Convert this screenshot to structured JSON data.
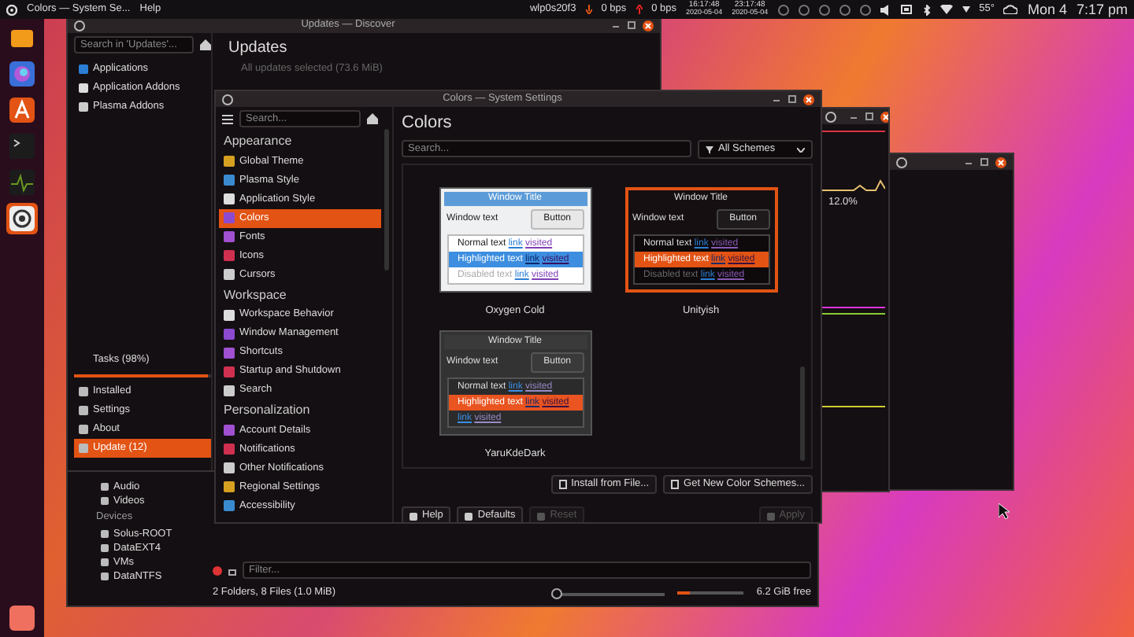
{
  "top_bar": {
    "app_title": "Colors — System Se...",
    "menu": "Help",
    "network": "wlp0s20f3",
    "download": "0 bps",
    "upload": "0 bps",
    "clocks": [
      {
        "time": "16:17:48",
        "date": "2020-05-04"
      },
      {
        "time": "23:17:48",
        "date": "2020-05-04"
      }
    ],
    "temperature": "55°",
    "day": "Mon 4",
    "time": "7:17 pm"
  },
  "dock": {
    "items": [
      {
        "selected": false
      },
      {
        "selected": false
      },
      {
        "selected": false
      },
      {
        "selected": false
      },
      {
        "selected": false
      },
      {
        "selected": true
      }
    ]
  },
  "files_window": {
    "places": [
      "Audio",
      "Videos"
    ],
    "devices_header": "Devices",
    "devices": [
      "Solus-ROOT",
      "DataEXT4",
      "VMs",
      "DataNTFS"
    ],
    "filter": {
      "placeholder": "Filter..."
    },
    "status": "2 Folders, 8 Files (1.0 MiB)",
    "zoom_slider": {
      "level": 0.0
    },
    "disk_usage": {
      "level": 0.18
    },
    "free_space": "6.2 GiB free"
  },
  "discover_window": {
    "title": "Updates — Discover",
    "search": {
      "placeholder": "Search in 'Updates'..."
    },
    "categories": [
      "Applications",
      "Application Addons",
      "Plasma Addons"
    ],
    "tasks": {
      "label": "Tasks (98%)",
      "level": 0.98
    },
    "nav": [
      {
        "label": "Installed",
        "selected": false
      },
      {
        "label": "Settings",
        "selected": false
      },
      {
        "label": "About",
        "selected": false
      },
      {
        "label": "Update (12)",
        "selected": true
      }
    ],
    "heading": "Updates",
    "summary": "All updates selected (73.6 MiB)"
  },
  "monitor_window": {
    "reading": "12.0%"
  },
  "settings_window": {
    "title": "Colors — System Settings",
    "search": {
      "placeholder": "Search..."
    },
    "sections": [
      {
        "title": "Appearance",
        "items": [
          {
            "label": "Global Theme",
            "selected": false
          },
          {
            "label": "Plasma Style",
            "selected": false
          },
          {
            "label": "Application Style",
            "selected": false
          },
          {
            "label": "Colors",
            "selected": true
          },
          {
            "label": "Fonts",
            "selected": false
          },
          {
            "label": "Icons",
            "selected": false
          },
          {
            "label": "Cursors",
            "selected": false
          }
        ]
      },
      {
        "title": "Workspace",
        "items": [
          {
            "label": "Workspace Behavior",
            "selected": false
          },
          {
            "label": "Window Management",
            "selected": false
          },
          {
            "label": "Shortcuts",
            "selected": false
          },
          {
            "label": "Startup and Shutdown",
            "selected": false
          },
          {
            "label": "Search",
            "selected": false
          }
        ]
      },
      {
        "title": "Personalization",
        "items": [
          {
            "label": "Account Details",
            "selected": false
          },
          {
            "label": "Notifications",
            "selected": false
          },
          {
            "label": "Other Notifications",
            "selected": false
          },
          {
            "label": "Regional Settings",
            "selected": false
          },
          {
            "label": "Accessibility",
            "selected": false
          }
        ]
      }
    ],
    "page_title": "Colors",
    "scheme_search": {
      "placeholder": "Search..."
    },
    "scheme_filter": "All Schemes",
    "schemes": [
      {
        "name": "Oxygen Cold",
        "kind": "light",
        "selected": false,
        "title_bar": "Window Title",
        "window_text": "Window text",
        "button": "Button",
        "normal_text": "Normal text",
        "link": "link",
        "visited": "visited",
        "highlighted_text": "Highlighted text",
        "highlighted_link": "link",
        "highlighted_visited": "visited",
        "disabled_text": "Disabled text",
        "disabled_link": "link",
        "disabled_visited": "visited"
      },
      {
        "name": "Unityish",
        "kind": "dark",
        "selected": true,
        "title_bar": "Window Title",
        "window_text": "Window text",
        "button": "Button",
        "normal_text": "Normal text",
        "link": "link",
        "visited": "visited",
        "highlighted_text": "Highlighted text",
        "highlighted_link": "link",
        "highlighted_visited": "visited",
        "disabled_text": "Disabled text",
        "disabled_link": "link",
        "disabled_visited": "visited"
      },
      {
        "name": "YaruKdeDark",
        "kind": "grey",
        "selected": false,
        "title_bar": "Window Title",
        "window_text": "Window text",
        "button": "Button",
        "normal_text": "Normal text",
        "link": "link",
        "visited": "visited",
        "highlighted_text": "Highlighted text",
        "highlighted_link": "link",
        "highlighted_visited": "visited",
        "disabled_link": "link",
        "disabled_visited": "visited"
      }
    ],
    "actions": [
      {
        "label": "Install from File..."
      },
      {
        "label": "Get New Color Schemes..."
      }
    ],
    "buttons": [
      {
        "label": "Help",
        "disabled": false
      },
      {
        "label": "Defaults",
        "disabled": false
      },
      {
        "label": "Reset",
        "disabled": true
      },
      {
        "label": "Apply",
        "disabled": true
      }
    ]
  }
}
